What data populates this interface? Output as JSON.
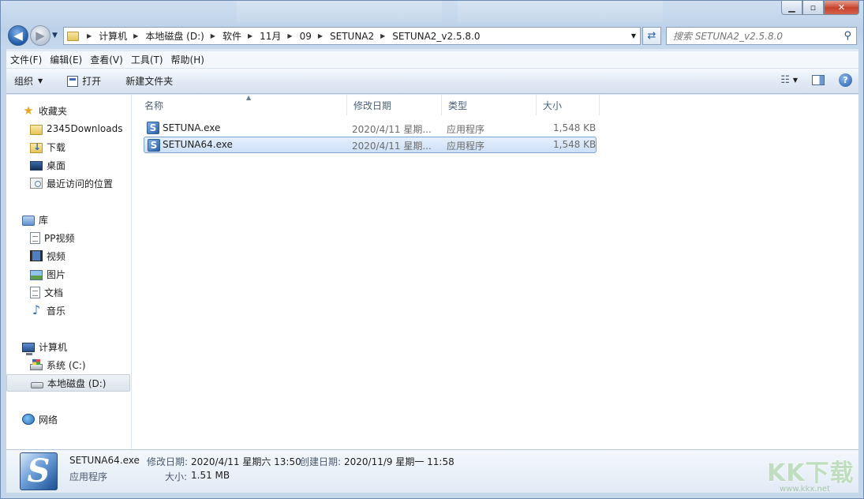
{
  "window": {
    "minimize_label": "▁",
    "maximize_label": "▫",
    "close_label": "✕"
  },
  "nav": {
    "back_label": "◀",
    "forward_label": "▶",
    "breadcrumbs": [
      "计算机",
      "本地磁盘 (D:)",
      "软件",
      "11月",
      "09",
      "SETUNA2",
      "SETUNA2_v2.5.8.0"
    ],
    "search_placeholder": "搜索 SETUNA2_v2.5.8.0"
  },
  "menubar": {
    "items": [
      "文件(F)",
      "编辑(E)",
      "查看(V)",
      "工具(T)",
      "帮助(H)"
    ]
  },
  "toolbar": {
    "organize_label": "组织",
    "open_label": "打开",
    "new_folder_label": "新建文件夹"
  },
  "sidebar": {
    "favorites_label": "收藏夹",
    "favorites": [
      "2345Downloads",
      "下载",
      "桌面",
      "最近访问的位置"
    ],
    "libraries_label": "库",
    "libraries": [
      "PP视频",
      "视频",
      "图片",
      "文档",
      "音乐"
    ],
    "computer_label": "计算机",
    "drives": [
      "系统 (C:)",
      "本地磁盘 (D:)"
    ],
    "network_label": "网络"
  },
  "filelist": {
    "columns": [
      "名称",
      "修改日期",
      "类型",
      "大小"
    ],
    "rows": [
      {
        "name": "SETUNA.exe",
        "date": "2020/4/11 星期...",
        "type": "应用程序",
        "size": "1,548 KB"
      },
      {
        "name": "SETUNA64.exe",
        "date": "2020/4/11 星期...",
        "type": "应用程序",
        "size": "1,548 KB"
      }
    ]
  },
  "details": {
    "file_name": "SETUNA64.exe",
    "modified_label": "修改日期:",
    "modified_value": "2020/4/11 星期六 13:50",
    "created_label": "创建日期:",
    "created_value": "2020/11/9 星期一 11:58",
    "file_type": "应用程序",
    "size_label": "大小:",
    "size_value": "1.51 MB"
  },
  "watermark": {
    "text": "KK下载",
    "sub": "www.kkx.net"
  },
  "colors": {
    "accent": "#3a6fb3",
    "selection": "#cde0f7"
  }
}
